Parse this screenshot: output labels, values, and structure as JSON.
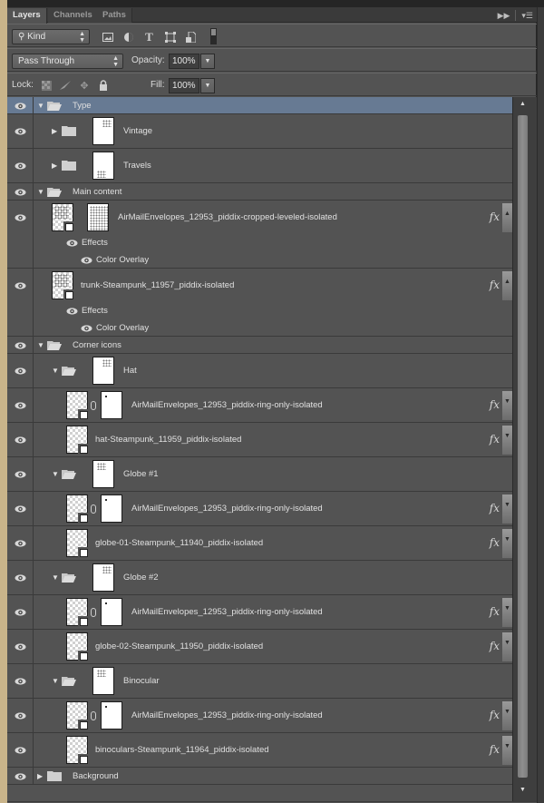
{
  "tabs": [
    {
      "label": "Layers",
      "active": true
    },
    {
      "label": "Channels",
      "active": false
    },
    {
      "label": "Paths",
      "active": false
    }
  ],
  "tab_actions": {
    "collapse_icon": "double-chevron-right-icon",
    "menu_icon": "panel-menu-icon"
  },
  "filter": {
    "kind_label": "Kind",
    "search_icon": "search-icon",
    "icons": [
      "pixel-layer-filter-icon",
      "adjustment-layer-filter-icon",
      "type-layer-filter-icon",
      "shape-layer-filter-icon",
      "smart-object-filter-icon"
    ],
    "type_glyph": "T"
  },
  "blend": {
    "mode": "Pass Through",
    "opacity_label": "Opacity:",
    "opacity": "100%"
  },
  "lock": {
    "label": "Lock:",
    "icons": [
      "lock-transparent-pixels-icon",
      "lock-image-pixels-icon",
      "lock-position-icon",
      "lock-all-icon"
    ],
    "fill_label": "Fill:",
    "fill": "100%"
  },
  "layers": [
    {
      "name": "Type",
      "kind": "group",
      "expanded": true,
      "depth": 0,
      "selected": true
    },
    {
      "name": "Vintage",
      "kind": "group",
      "expanded": false,
      "depth": 1,
      "mask": true
    },
    {
      "name": "Travels",
      "kind": "group",
      "expanded": false,
      "depth": 1,
      "mask": true
    },
    {
      "name": "Main content",
      "kind": "group",
      "expanded": true,
      "depth": 0
    },
    {
      "name": "AirMailEnvelopes_12953_piddix-cropped-leveled-isolated",
      "kind": "smart",
      "depth": 1,
      "mask": true,
      "fx": true,
      "effects_label": "Effects",
      "effect": "Color Overlay"
    },
    {
      "name": "trunk-Steampunk_11957_piddix-isolated",
      "kind": "smart",
      "depth": 1,
      "fx": true,
      "effects_label": "Effects",
      "effect": "Color Overlay"
    },
    {
      "name": "Corner icons",
      "kind": "group",
      "expanded": true,
      "depth": 0
    },
    {
      "name": "Hat",
      "kind": "group",
      "expanded": true,
      "depth": 1,
      "mask": true
    },
    {
      "name": "AirMailEnvelopes_12953_piddix-ring-only-isolated",
      "kind": "smart",
      "depth": 2,
      "mask": true,
      "linked": true,
      "fx": true
    },
    {
      "name": "hat-Steampunk_11959_piddix-isolated",
      "kind": "smart",
      "depth": 2,
      "fx": true
    },
    {
      "name": "Globe #1",
      "kind": "group",
      "expanded": true,
      "depth": 1,
      "mask": true
    },
    {
      "name": "AirMailEnvelopes_12953_piddix-ring-only-isolated",
      "kind": "smart",
      "depth": 2,
      "mask": true,
      "linked": true,
      "fx": true
    },
    {
      "name": "globe-01-Steampunk_11940_piddix-isolated",
      "kind": "smart",
      "depth": 2,
      "fx": true
    },
    {
      "name": "Globe #2",
      "kind": "group",
      "expanded": true,
      "depth": 1,
      "mask": true
    },
    {
      "name": "AirMailEnvelopes_12953_piddix-ring-only-isolated",
      "kind": "smart",
      "depth": 2,
      "mask": true,
      "linked": true,
      "fx": true
    },
    {
      "name": "globe-02-Steampunk_11950_piddix-isolated",
      "kind": "smart",
      "depth": 2,
      "fx": true
    },
    {
      "name": "Binocular",
      "kind": "group",
      "expanded": true,
      "depth": 1,
      "mask": true
    },
    {
      "name": "AirMailEnvelopes_12953_piddix-ring-only-isolated",
      "kind": "smart",
      "depth": 2,
      "mask": true,
      "linked": true,
      "fx": true
    },
    {
      "name": "binoculars-Steampunk_11964_piddix-isolated",
      "kind": "smart",
      "depth": 2,
      "fx": true
    },
    {
      "name": "Background",
      "kind": "group",
      "expanded": false,
      "depth": 0
    }
  ],
  "fx_label": "fx",
  "colors": {
    "selected_row": "#677a93",
    "panel": "#535353"
  }
}
